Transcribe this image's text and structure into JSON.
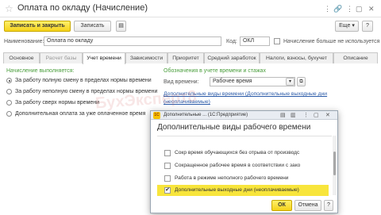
{
  "window": {
    "title": "Оплата по окладу (Начисление)",
    "star": "☆",
    "icons": [
      "⋮",
      "🔗",
      "⋮",
      "▢",
      "✕"
    ]
  },
  "toolbar": {
    "save_close": "Записать и закрыть",
    "save": "Записать",
    "more": "Еще",
    "more_arrow": "▾",
    "help": "?"
  },
  "fields": {
    "name_label": "Наименование:",
    "name_value": "Оплата по окладу",
    "code_label": "Код:",
    "code_value": "ОКЛ",
    "not_used_label": "Начисление больше не используется"
  },
  "tabs": [
    {
      "label": "Основное"
    },
    {
      "label": "Расчет базы"
    },
    {
      "label": "Учет времени"
    },
    {
      "label": "Зависимости"
    },
    {
      "label": "Приоритет"
    },
    {
      "label": "Средний заработок"
    },
    {
      "label": "Налоги, взносы, бухучет"
    },
    {
      "label": "Описание"
    }
  ],
  "left_panel": {
    "title": "Начисление выполняется:",
    "options": [
      "За работу полную смену в пределах нормы времени",
      "За работу неполную смену в пределах нормы времени",
      "За работу сверх нормы времени",
      "Дополнительная оплата за уже оплаченное время"
    ]
  },
  "right_panel": {
    "title": "Обозначения в учете времени и стажах",
    "time_kind_label": "Вид времени:",
    "time_kind_value": "Рабочее время",
    "link_line1": "Дополнительные виды времени (Дополнительные выходные дни",
    "link_line2": "(неоплачиваемые)"
  },
  "watermark": "БухЭксперт8",
  "dialog": {
    "header": "Дополнительные ... (1С:Предприятие)",
    "header_icons": [
      "▤",
      "▥",
      "⋮",
      "▢",
      "✕"
    ],
    "logo": "1С",
    "title": "Дополнительные виды рабочего времени",
    "items": [
      {
        "label": "Сокр время обучающихся без отрыва от производс",
        "checked": false
      },
      {
        "label": "Сокращенное рабочее время в соответствии с зако",
        "checked": false
      },
      {
        "label": "Работа в режиме неполного рабочего времени",
        "checked": false
      },
      {
        "label": "Дополнительные выходные дни (неоплачиваемые)",
        "checked": true
      }
    ],
    "ok": "ОК",
    "cancel": "Отмена",
    "help": "?",
    "check_mark": "✔"
  },
  "colors": {
    "primary_button": "#f5d21a",
    "selected_row": "#f8e53c",
    "section_title": "#4a9e3c",
    "link": "#2a5aa8"
  }
}
